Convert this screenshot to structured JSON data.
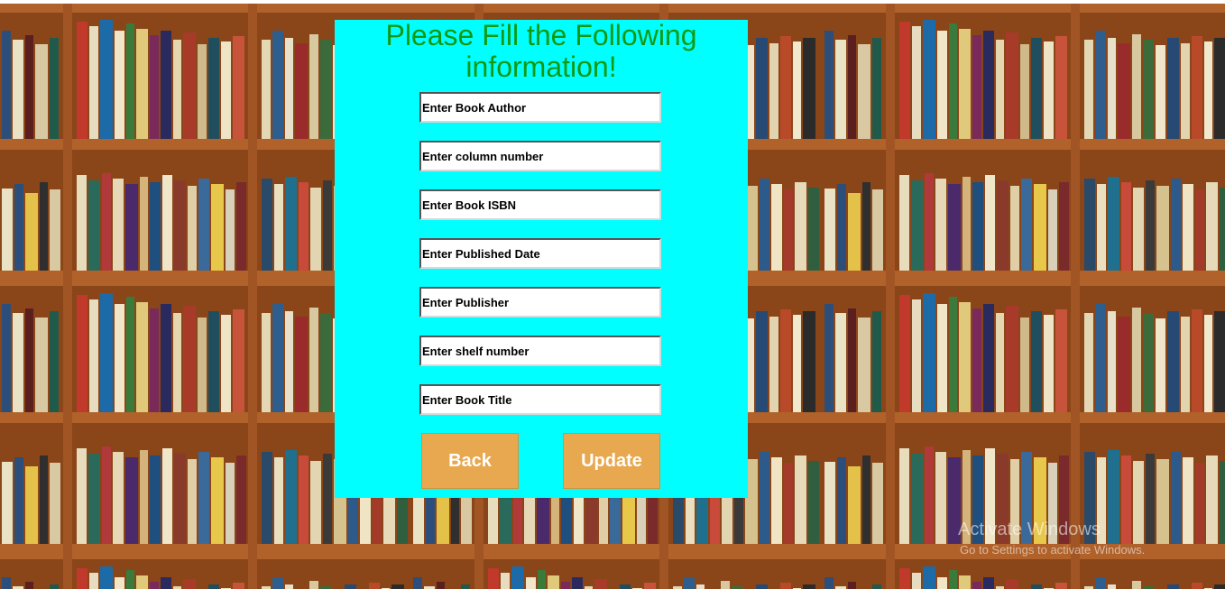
{
  "form": {
    "title": "Please Fill the Following information!",
    "fields": [
      {
        "placeholder": "Enter Book Author",
        "value": ""
      },
      {
        "placeholder": "Enter column number",
        "value": ""
      },
      {
        "placeholder": "Enter Book ISBN",
        "value": ""
      },
      {
        "placeholder": "Enter Published Date",
        "value": ""
      },
      {
        "placeholder": "Enter Publisher",
        "value": ""
      },
      {
        "placeholder": "Enter shelf number",
        "value": ""
      },
      {
        "placeholder": "Enter Book Title",
        "value": ""
      }
    ],
    "back_label": "Back",
    "update_label": "Update"
  },
  "watermark": {
    "title": "Activate Windows",
    "subtitle": "Go to Settings to activate Windows."
  },
  "colors": {
    "panel_bg": "#00ffff",
    "title_text": "#119911",
    "button_bg": "#e8a84f",
    "button_text": "#ffffff",
    "shelf_wood": "#7a3a14"
  },
  "background": {
    "image": "tiled bookshelf photograph"
  }
}
